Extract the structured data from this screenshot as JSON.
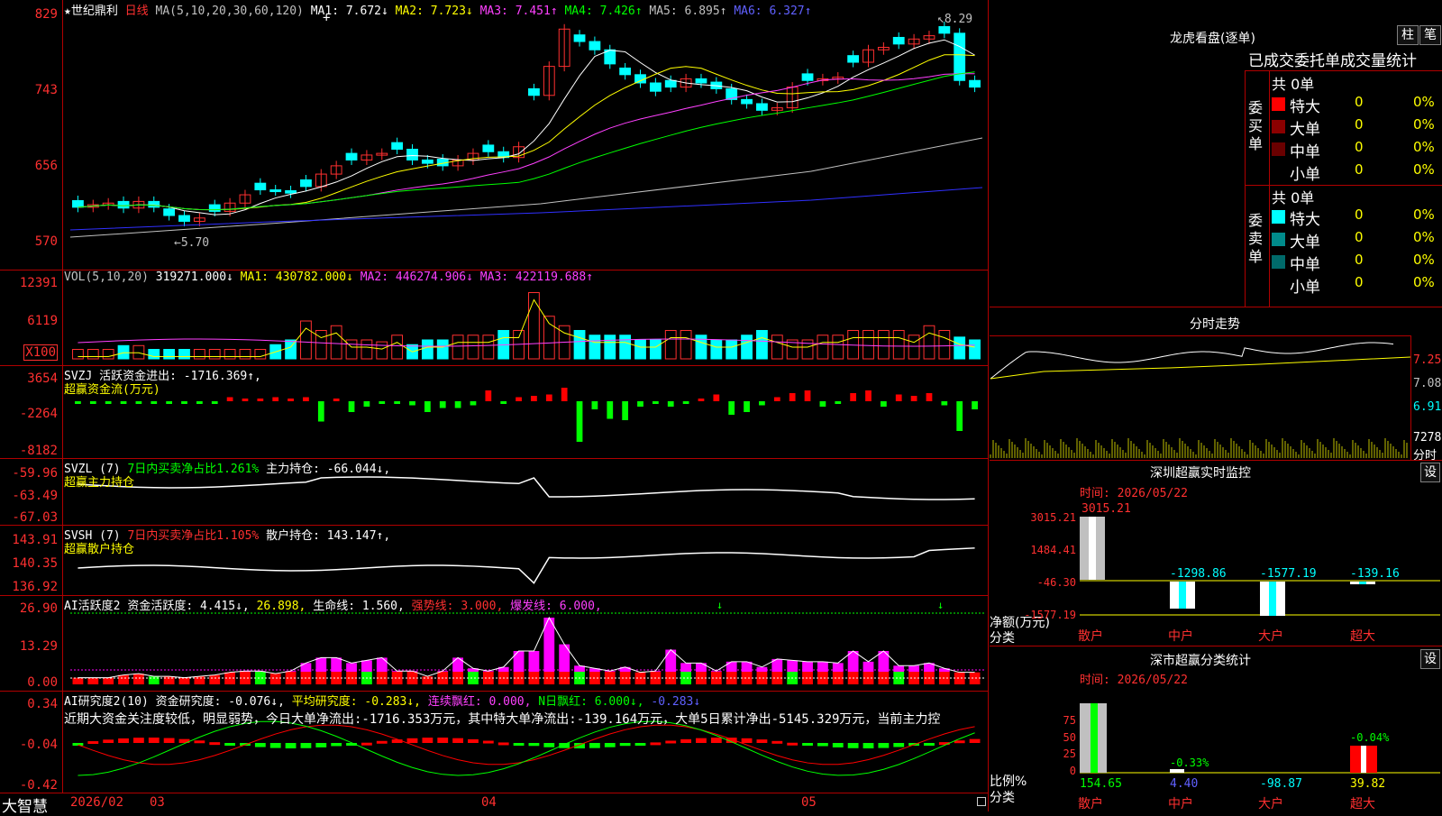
{
  "colors": {
    "up": "#ff3030",
    "down": "#00ffff",
    "ma1": "#ffffff",
    "ma2": "#ffff00",
    "ma3": "#ff40ff",
    "ma4": "#00ff00",
    "ma5": "#c0c0c0",
    "ma6": "#3030ff"
  },
  "main": {
    "star": "★",
    "stock_name": "世纪鼎利",
    "period": "日线",
    "ma_params": "MA(5,10,20,30,60,120)",
    "ma1": "MA1: 7.672↓",
    "ma2": "MA2: 7.723↓",
    "ma3": "MA3: 7.451↑",
    "ma4": "MA4: 7.426↑",
    "ma5": "MA5: 6.895↑",
    "ma6": "MA6: 6.327↑",
    "axis": [
      "829",
      "743",
      "656",
      "570"
    ],
    "high_label": "8.29",
    "low_label": "5.70",
    "cross": "+"
  },
  "vol": {
    "name": "VOL(5,10,20)",
    "value": "319271.000↓",
    "ma1": "MA1: 430782.000↓",
    "ma2": "MA2: 446274.906↓",
    "ma3": "MA3: 422119.688↑",
    "axis": [
      "12391",
      "6119"
    ],
    "unit": "X100"
  },
  "svzj": {
    "name": "SVZJ",
    "text": "活跃资金进出: -1716.369↑,",
    "subtitle": "超赢资金流(万元)",
    "axis": [
      "3654",
      "-2264",
      "-8182"
    ]
  },
  "svzl": {
    "name": "SVZL (7)",
    "text1": "7日内买卖净占比1.261%",
    "text2": "主力持仓: -66.044↓,",
    "subtitle": "超赢主力持仓",
    "axis": [
      "-59.96",
      "-63.49",
      "-67.03"
    ]
  },
  "svsh": {
    "name": "SVSH (7)",
    "text1": "7日内买卖净占比1.105%",
    "text2": "散户持仓: 143.147↑,",
    "subtitle": "超赢散户持仓",
    "axis": [
      "143.91",
      "140.35",
      "136.92"
    ]
  },
  "ai1": {
    "name": "AI活跃度2",
    "t1": "资金活跃度: 4.415↓,",
    "t2": "26.898,",
    "t3": "生命线: 1.560,",
    "t4": "强势线: 3.000,",
    "t5": "爆发线: 6.000,",
    "axis": [
      "26.90",
      "13.29",
      "0.00"
    ]
  },
  "ai2": {
    "name": "AI研究度2(10)",
    "t1": "资金研究度: -0.076↓,",
    "t2": "平均研究度: -0.283↓,",
    "t3": "连续飘红: 0.000,",
    "t4": "N日飘红: 6.000↓,",
    "t5": "-0.283↓",
    "comment": "近期大资金关注度较低，明显弱势，今日大单净流出:-1716.353万元，其中特大单净流出:-139.164万元，大单5日累计净出-5145.329万元，当前主力控",
    "axis": [
      "0.34",
      "-0.04",
      "-0.42"
    ]
  },
  "dates": [
    "2026/02",
    "03",
    "04",
    "05"
  ],
  "bottom_logo": "大智慧",
  "right": {
    "lhb_title": "龙虎看盘(逐单)",
    "btn_pillar": "柱",
    "btn_grid": "笔",
    "tabs": [
      "已成交",
      "委托单",
      "成交量统计"
    ],
    "buy": {
      "label": "委买单",
      "total": "共 0单",
      "rows": [
        {
          "name": "特大",
          "v": "0",
          "p": "0%",
          "c": "#ff0000"
        },
        {
          "name": "大单",
          "v": "0",
          "p": "0%",
          "c": "#8b0000"
        },
        {
          "name": "中单",
          "v": "0",
          "p": "0%",
          "c": "#6a0000"
        },
        {
          "name": "小单",
          "v": "0",
          "p": "0%",
          "c": "#000000"
        }
      ]
    },
    "sell": {
      "label": "委卖单",
      "total": "共 0单",
      "rows": [
        {
          "name": "特大",
          "v": "0",
          "p": "0%",
          "c": "#00ffff"
        },
        {
          "name": "大单",
          "v": "0",
          "p": "0%",
          "c": "#008b8b"
        },
        {
          "name": "中单",
          "v": "0",
          "p": "0%",
          "c": "#006a6a"
        },
        {
          "name": "小单",
          "v": "0",
          "p": "0%",
          "c": "#000000"
        }
      ]
    },
    "intraday": {
      "title": "分时走势",
      "axis": [
        "7.25",
        "7.08",
        "6.91"
      ],
      "vol": "7278",
      "vol_unit": "分时"
    },
    "monitor": {
      "title": "深圳超赢实时监控",
      "btn": "设",
      "time": "时间: 2026/05/22",
      "axis": [
        "3015.21",
        "1484.41",
        "-46.30",
        "-1577.19"
      ],
      "values": [
        "3015.21",
        "-1298.86",
        "-1577.19",
        "-139.16"
      ],
      "ylabel": "净额(万元)",
      "xlabel": "分类",
      "cats": [
        "散户",
        "中户",
        "大户",
        "超大"
      ]
    },
    "stat": {
      "title": "深市超赢分类统计",
      "btn": "设",
      "time": "时间: 2026/05/22",
      "axis": [
        "75",
        "50",
        "25",
        "0"
      ],
      "tops": [
        "",
        "-0.33%",
        "",
        "-0.04%"
      ],
      "bottoms": [
        "154.65",
        "4.40",
        "-98.87",
        "39.82"
      ],
      "ylabel": "比例%",
      "xlabel": "分类",
      "cats": [
        "散户",
        "中户",
        "大户",
        "超大"
      ]
    }
  }
}
